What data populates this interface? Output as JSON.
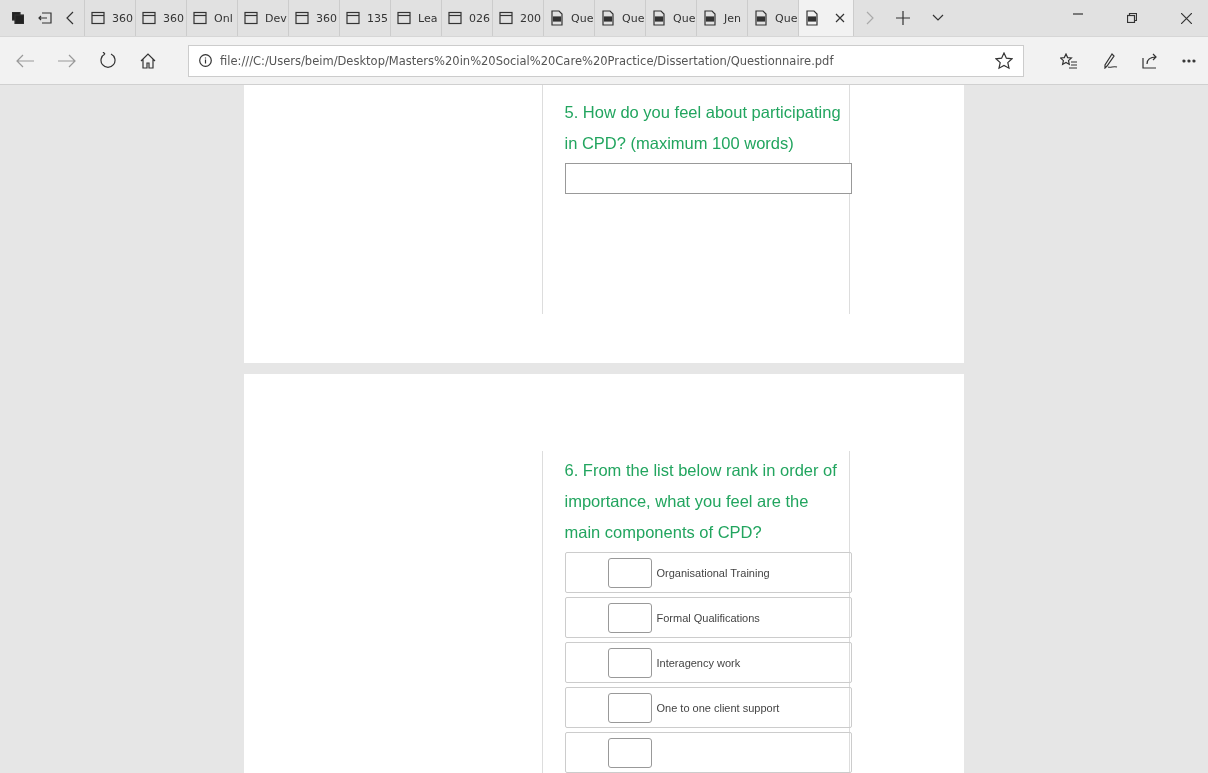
{
  "tabs": [
    {
      "kind": "page",
      "label": "360",
      "selected": false
    },
    {
      "kind": "page",
      "label": "360",
      "selected": false
    },
    {
      "kind": "page",
      "label": "Onl",
      "selected": false
    },
    {
      "kind": "page",
      "label": "Dev",
      "selected": false
    },
    {
      "kind": "page",
      "label": "360",
      "selected": false
    },
    {
      "kind": "page",
      "label": "135",
      "selected": false
    },
    {
      "kind": "page",
      "label": "Lea",
      "selected": false
    },
    {
      "kind": "page",
      "label": "026",
      "selected": false
    },
    {
      "kind": "page",
      "label": "200",
      "selected": false
    },
    {
      "kind": "pdf",
      "label": "Que",
      "selected": false
    },
    {
      "kind": "pdf",
      "label": "Que",
      "selected": false
    },
    {
      "kind": "pdf",
      "label": "Que",
      "selected": false
    },
    {
      "kind": "pdf",
      "label": "Jen",
      "selected": false
    },
    {
      "kind": "pdf",
      "label": "Que",
      "selected": false
    },
    {
      "kind": "pdf",
      "selected": true
    }
  ],
  "address_bar": {
    "url": "file:///C:/Users/beim/Desktop/Masters%20in%20Social%20Care%20Practice/Dissertation/Questionnaire.pdf"
  },
  "pages": [
    {
      "question": "5. How do you feel about participating in CPD? (maximum 100 words)"
    },
    {
      "question": "6. From the list below rank in order of importance, what you feel are the main components of CPD?",
      "options": [
        "Organisational Training",
        "Formal Qualifications",
        "Interagency work",
        "One to one client support"
      ]
    }
  ]
}
